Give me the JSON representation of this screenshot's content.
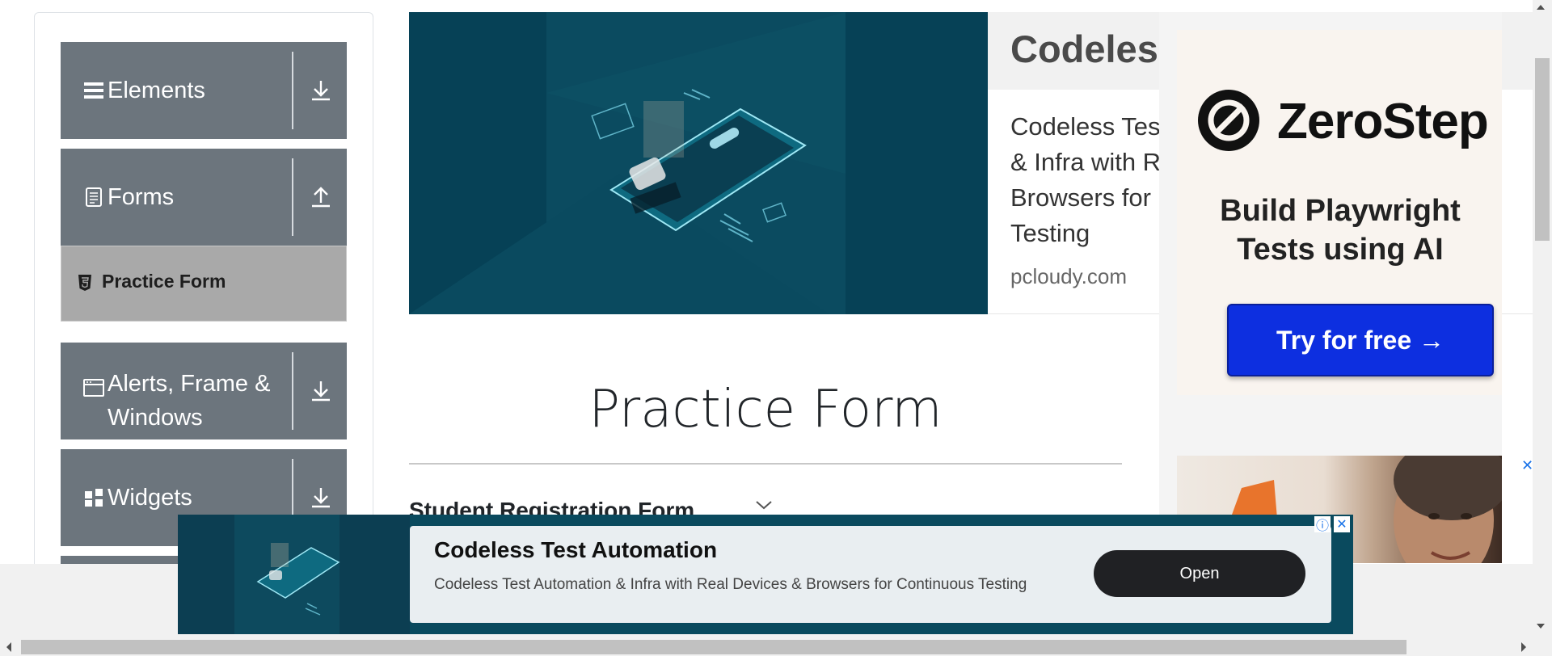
{
  "sidebar": {
    "groups": [
      {
        "label": "Elements",
        "icon": "hamburger-icon",
        "toggle": "download-arrow-icon"
      },
      {
        "label": "Forms",
        "icon": "document-icon",
        "toggle": "upload-arrow-icon"
      },
      {
        "label": "Alerts, Frame & Windows",
        "icon": "window-icon",
        "toggle": "download-arrow-icon"
      },
      {
        "label": "Widgets",
        "icon": "widgets-icon",
        "toggle": "download-arrow-icon"
      }
    ],
    "active_item": {
      "label": "Practice Form",
      "icon": "html5-icon"
    }
  },
  "top_ad": {
    "title": "Codeless",
    "body": "Codeless Tes\n& Infra with R\nBrowsers for\nTesting",
    "domain": "pcloudy.com"
  },
  "right_ad": {
    "brand": "ZeroStep",
    "headline": "Build Playwright\nTests using AI",
    "button": "Try for free →",
    "close_label": "✕"
  },
  "page": {
    "title": "Practice Form",
    "subtitle": "Student Registration Form"
  },
  "bottom_ad": {
    "title": "Codeless Test Automation",
    "text": "Codeless Test Automation & Infra with Real Devices & Browsers for Continuous Testing",
    "button": "Open",
    "info_label": "ⓘ",
    "close_label": "✕"
  },
  "colors": {
    "sidebar_group_bg": "#6c757d",
    "active_item_bg": "#a9a9a9",
    "ad_teal": "#063b4d",
    "cta_blue": "#0d2fe0"
  }
}
